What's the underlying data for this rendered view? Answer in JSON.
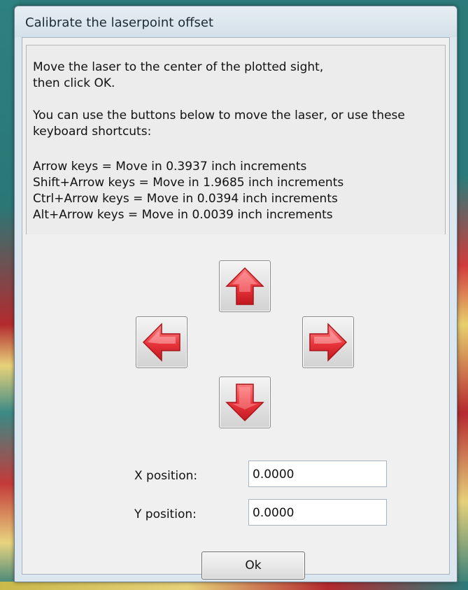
{
  "window": {
    "title": "Calibrate the laserpoint offset"
  },
  "instructions": {
    "line1": "Move the laser to the center of the plotted sight,",
    "line2": "then click OK.",
    "line3": "You can use the buttons below to move the laser, or use these",
    "line4": "keyboard shortcuts:",
    "shortcut1": "Arrow keys = Move in 0.3937 inch increments",
    "shortcut2": "Shift+Arrow keys = Move in 1.9685 inch increments",
    "shortcut3": "Ctrl+Arrow keys = Move in 0.0394 inch increments",
    "shortcut4": "Alt+Arrow keys = Move in 0.0039 inch increments"
  },
  "buttons": {
    "up": "arrow-up-icon",
    "down": "arrow-down-icon",
    "left": "arrow-left-icon",
    "right": "arrow-right-icon",
    "ok_label": "Ok"
  },
  "fields": {
    "x_label": "X position:",
    "x_value": "0.0000",
    "y_label": "Y position:",
    "y_value": "0.0000"
  },
  "colors": {
    "arrow_red": "#e8343b",
    "dialog_bg": "#f0f0f0"
  }
}
